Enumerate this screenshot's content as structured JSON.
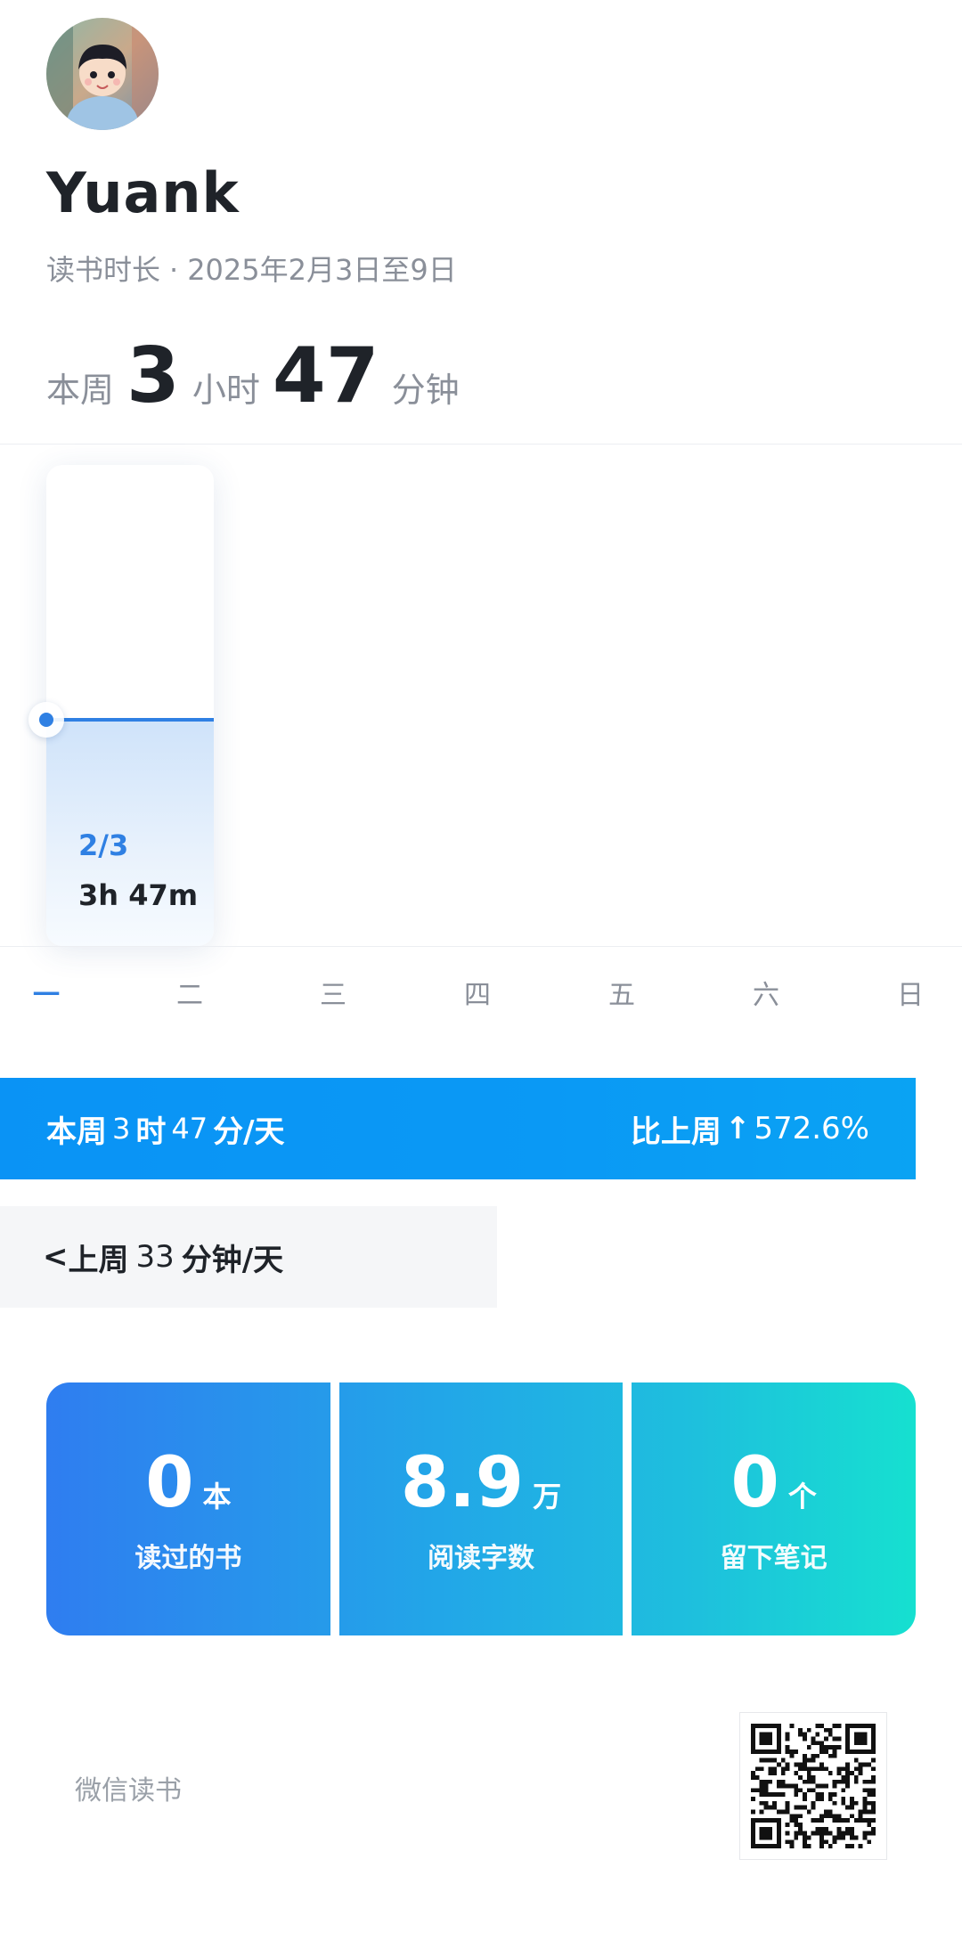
{
  "profile": {
    "username": "Yuank",
    "subtitle_label": "读书时长",
    "date_range": "2025年2月3日至9日"
  },
  "week_total": {
    "prefix": "本周",
    "hours": "3",
    "hours_unit": "小时",
    "minutes": "47",
    "minutes_unit": "分钟"
  },
  "chart": {
    "selected_date": "2/3",
    "selected_duration": "3h 47m",
    "selected_level_fraction": 0.47,
    "days": [
      "一",
      "二",
      "三",
      "四",
      "五",
      "六",
      "日"
    ],
    "active_day_index": 0
  },
  "chart_data": {
    "type": "bar",
    "categories": [
      "一",
      "二",
      "三",
      "四",
      "五",
      "六",
      "日"
    ],
    "values": [
      227,
      0,
      0,
      0,
      0,
      0,
      0
    ],
    "annotations": [
      {
        "category": "一",
        "date": "2/3",
        "duration": "3h 47m"
      }
    ]
  },
  "banner": {
    "left_prefix": "本周",
    "left_hours": "3",
    "left_hours_unit": "时",
    "left_minutes": "47",
    "left_suffix": "分/天",
    "right_label": "比上周",
    "right_arrow": "↑",
    "right_value": "572.6%"
  },
  "last_week": {
    "chevron": "<",
    "label": "上周",
    "value": "33",
    "suffix": "分钟/天"
  },
  "stats": [
    {
      "value": "0",
      "unit": "本",
      "label": "读过的书"
    },
    {
      "value": "8.9",
      "unit": "万",
      "label": "阅读字数"
    },
    {
      "value": "0",
      "unit": "个",
      "label": "留下笔记"
    }
  ],
  "footer": {
    "brand": "微信读书"
  },
  "colors": {
    "accent": "#2f80e3",
    "banner": "#0a99f5",
    "stats_start": "#2f7df0",
    "stats_end": "#16e0d0"
  }
}
